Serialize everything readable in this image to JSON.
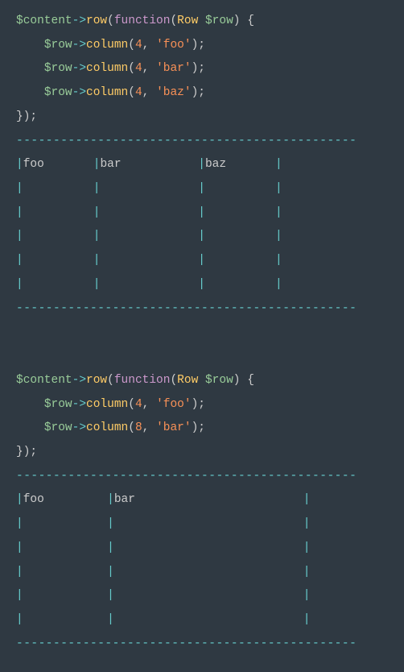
{
  "block1": {
    "code": {
      "l1": {
        "var1": "$content",
        "arrow": "->",
        "method": "row",
        "open": "(",
        "kw": "function",
        "open2": "(",
        "class": "Row",
        "sp": " ",
        "var2": "$row",
        "close": ")",
        "brace": " {"
      },
      "l2": {
        "indent": "    ",
        "var": "$row",
        "arrow": "->",
        "method": "column",
        "open": "(",
        "num": "4",
        "comma": ", ",
        "str": "'foo'",
        "close": ");"
      },
      "l3": {
        "indent": "    ",
        "var": "$row",
        "arrow": "->",
        "method": "column",
        "open": "(",
        "num": "4",
        "comma": ", ",
        "str": "'bar'",
        "close": ");"
      },
      "l4": {
        "indent": "    ",
        "var": "$row",
        "arrow": "->",
        "method": "column",
        "open": "(",
        "num": "4",
        "comma": ", ",
        "str": "'baz'",
        "close": ");"
      },
      "l5": {
        "text": "});"
      }
    },
    "dashes": "----------------------------------------------",
    "header": {
      "c1": "foo",
      "c2": "bar",
      "c3": "baz"
    }
  },
  "block2": {
    "code": {
      "l1": {
        "var1": "$content",
        "arrow": "->",
        "method": "row",
        "open": "(",
        "kw": "function",
        "open2": "(",
        "class": "Row",
        "sp": " ",
        "var2": "$row",
        "close": ")",
        "brace": " {"
      },
      "l2": {
        "indent": "    ",
        "var": "$row",
        "arrow": "->",
        "method": "column",
        "open": "(",
        "num": "4",
        "comma": ", ",
        "str": "'foo'",
        "close": ");"
      },
      "l3": {
        "indent": "    ",
        "var": "$row",
        "arrow": "->",
        "method": "column",
        "open": "(",
        "num": "8",
        "comma": ", ",
        "str": "'bar'",
        "close": ");"
      },
      "l4": {
        "text": "});"
      }
    },
    "dashes": "----------------------------------------------",
    "header": {
      "c1": "foo",
      "c2": "bar"
    }
  }
}
